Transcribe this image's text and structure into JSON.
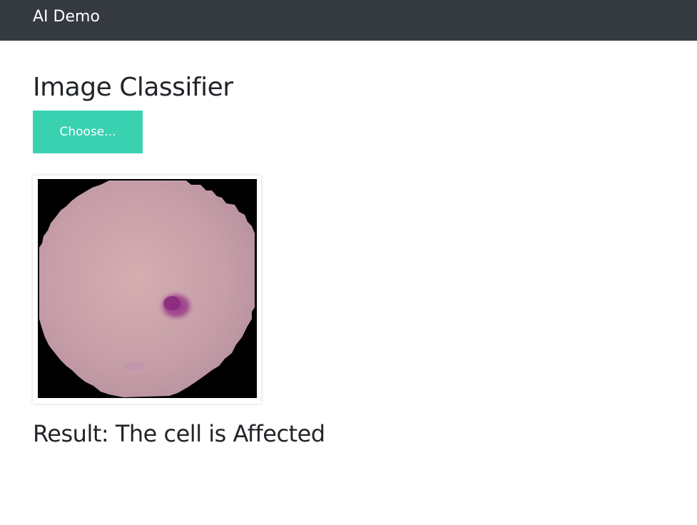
{
  "navbar": {
    "brand": "AI Demo"
  },
  "page": {
    "title": "Image Classifier",
    "choose_button_label": "Choose...",
    "result_text": "Result: The cell is Affected"
  },
  "colors": {
    "navbar_bg": "#343a40",
    "button_bg": "#3ad1b1",
    "cell": "#c9a0a7",
    "stain": "#9a3d8c"
  },
  "icons": {
    "preview": "blood-cell-image"
  }
}
